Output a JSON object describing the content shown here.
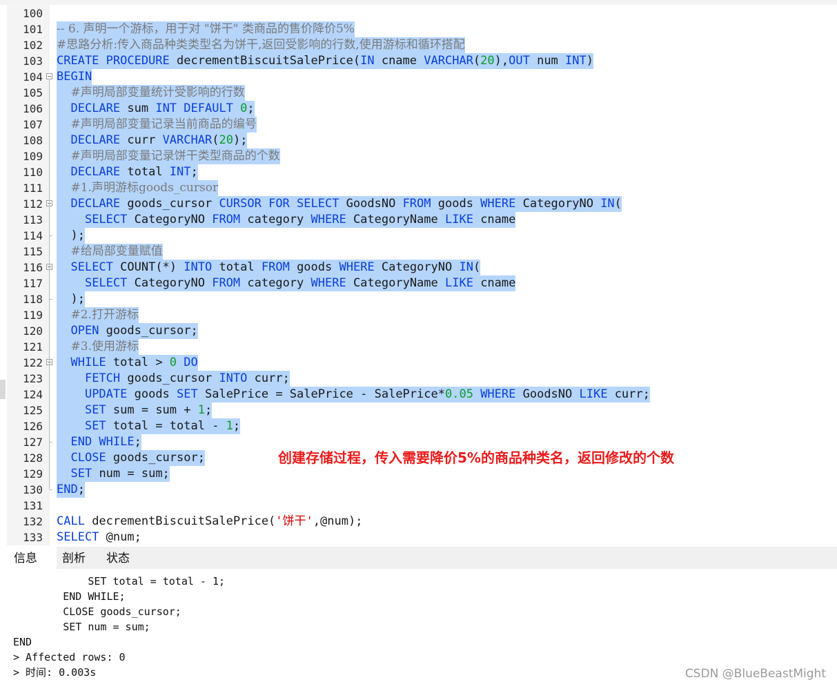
{
  "editor": {
    "lines": [
      {
        "no": "100",
        "tokens": []
      },
      {
        "no": "101",
        "tokens": [
          {
            "t": "-- 6. 声明一个游标，用于对 \"饼干\" 类商品的售价降价5%",
            "c": "c"
          }
        ]
      },
      {
        "no": "102",
        "tokens": [
          {
            "t": "#思路分析:传入商品种类类型名为饼干,返回受影响的行数,使用游标和循环搭配",
            "c": "c"
          }
        ]
      },
      {
        "no": "103",
        "tokens": [
          {
            "t": "CREATE PROCEDURE",
            "c": "k"
          },
          {
            "t": " decrementBiscuitSalePrice(",
            "c": ""
          },
          {
            "t": "IN",
            "c": "k"
          },
          {
            "t": " cname ",
            "c": ""
          },
          {
            "t": "VARCHAR",
            "c": "k"
          },
          {
            "t": "(",
            "c": ""
          },
          {
            "t": "20",
            "c": "n"
          },
          {
            "t": "),",
            "c": ""
          },
          {
            "t": "OUT",
            "c": "k"
          },
          {
            "t": " num ",
            "c": ""
          },
          {
            "t": "INT",
            "c": "k"
          },
          {
            "t": ")",
            "c": ""
          }
        ]
      },
      {
        "no": "104",
        "tokens": [
          {
            "t": "BEGIN",
            "c": "k"
          }
        ]
      },
      {
        "no": "105",
        "tokens": [
          {
            "t": "  ",
            "c": ""
          },
          {
            "t": "#声明局部变量统计受影响的行数",
            "c": "c"
          }
        ]
      },
      {
        "no": "106",
        "tokens": [
          {
            "t": "  ",
            "c": ""
          },
          {
            "t": "DECLARE",
            "c": "k"
          },
          {
            "t": " sum ",
            "c": ""
          },
          {
            "t": "INT DEFAULT",
            "c": "k"
          },
          {
            "t": " ",
            "c": ""
          },
          {
            "t": "0",
            "c": "n"
          },
          {
            "t": ";",
            "c": ""
          }
        ]
      },
      {
        "no": "107",
        "tokens": [
          {
            "t": "  ",
            "c": ""
          },
          {
            "t": "#声明局部变量记录当前商品的编号",
            "c": "c"
          }
        ]
      },
      {
        "no": "108",
        "tokens": [
          {
            "t": "  ",
            "c": ""
          },
          {
            "t": "DECLARE",
            "c": "k"
          },
          {
            "t": " curr ",
            "c": ""
          },
          {
            "t": "VARCHAR",
            "c": "k"
          },
          {
            "t": "(",
            "c": ""
          },
          {
            "t": "20",
            "c": "n"
          },
          {
            "t": ");",
            "c": ""
          }
        ]
      },
      {
        "no": "109",
        "tokens": [
          {
            "t": "  ",
            "c": ""
          },
          {
            "t": "#声明局部变量记录饼干类型商品的个数",
            "c": "c"
          }
        ]
      },
      {
        "no": "110",
        "tokens": [
          {
            "t": "  ",
            "c": ""
          },
          {
            "t": "DECLARE",
            "c": "k"
          },
          {
            "t": " total ",
            "c": ""
          },
          {
            "t": "INT",
            "c": "k"
          },
          {
            "t": ";",
            "c": ""
          }
        ]
      },
      {
        "no": "111",
        "tokens": [
          {
            "t": "  ",
            "c": ""
          },
          {
            "t": "#1.声明游标goods_cursor",
            "c": "c"
          }
        ]
      },
      {
        "no": "112",
        "tokens": [
          {
            "t": "  ",
            "c": ""
          },
          {
            "t": "DECLARE",
            "c": "k"
          },
          {
            "t": " goods_cursor ",
            "c": ""
          },
          {
            "t": "CURSOR FOR SELECT",
            "c": "k"
          },
          {
            "t": " GoodsNO ",
            "c": ""
          },
          {
            "t": "FROM",
            "c": "k"
          },
          {
            "t": " goods ",
            "c": ""
          },
          {
            "t": "WHERE",
            "c": "k"
          },
          {
            "t": " CategoryNO ",
            "c": ""
          },
          {
            "t": "IN",
            "c": "k"
          },
          {
            "t": "(",
            "c": ""
          }
        ]
      },
      {
        "no": "113",
        "tokens": [
          {
            "t": "    ",
            "c": ""
          },
          {
            "t": "SELECT",
            "c": "k"
          },
          {
            "t": " CategoryNO ",
            "c": ""
          },
          {
            "t": "FROM",
            "c": "k"
          },
          {
            "t": " category ",
            "c": ""
          },
          {
            "t": "WHERE",
            "c": "k"
          },
          {
            "t": " CategoryName ",
            "c": ""
          },
          {
            "t": "LIKE",
            "c": "k"
          },
          {
            "t": " cname",
            "c": ""
          }
        ]
      },
      {
        "no": "114",
        "tokens": [
          {
            "t": "  );",
            "c": ""
          }
        ]
      },
      {
        "no": "115",
        "tokens": [
          {
            "t": "  ",
            "c": ""
          },
          {
            "t": "#给局部变量赋值",
            "c": "c"
          }
        ]
      },
      {
        "no": "116",
        "tokens": [
          {
            "t": "  ",
            "c": ""
          },
          {
            "t": "SELECT",
            "c": "k"
          },
          {
            "t": " COUNT(*) ",
            "c": ""
          },
          {
            "t": "INTO",
            "c": "k"
          },
          {
            "t": " total ",
            "c": ""
          },
          {
            "t": "FROM",
            "c": "k"
          },
          {
            "t": " goods ",
            "c": ""
          },
          {
            "t": "WHERE",
            "c": "k"
          },
          {
            "t": " CategoryNO ",
            "c": ""
          },
          {
            "t": "IN",
            "c": "k"
          },
          {
            "t": "(",
            "c": ""
          }
        ]
      },
      {
        "no": "117",
        "tokens": [
          {
            "t": "    ",
            "c": ""
          },
          {
            "t": "SELECT",
            "c": "k"
          },
          {
            "t": " CategoryNO ",
            "c": ""
          },
          {
            "t": "FROM",
            "c": "k"
          },
          {
            "t": " category ",
            "c": ""
          },
          {
            "t": "WHERE",
            "c": "k"
          },
          {
            "t": " CategoryName ",
            "c": ""
          },
          {
            "t": "LIKE",
            "c": "k"
          },
          {
            "t": " cname",
            "c": ""
          }
        ]
      },
      {
        "no": "118",
        "tokens": [
          {
            "t": "  );",
            "c": ""
          }
        ]
      },
      {
        "no": "119",
        "tokens": [
          {
            "t": "  ",
            "c": ""
          },
          {
            "t": "#2.打开游标",
            "c": "c"
          }
        ]
      },
      {
        "no": "120",
        "tokens": [
          {
            "t": "  ",
            "c": ""
          },
          {
            "t": "OPEN",
            "c": "k"
          },
          {
            "t": " goods_cursor;",
            "c": ""
          }
        ]
      },
      {
        "no": "121",
        "tokens": [
          {
            "t": "  ",
            "c": ""
          },
          {
            "t": "#3.使用游标",
            "c": "c"
          }
        ]
      },
      {
        "no": "122",
        "tokens": [
          {
            "t": "  ",
            "c": ""
          },
          {
            "t": "WHILE",
            "c": "k"
          },
          {
            "t": " total > ",
            "c": ""
          },
          {
            "t": "0",
            "c": "n"
          },
          {
            "t": " ",
            "c": ""
          },
          {
            "t": "DO",
            "c": "k"
          }
        ]
      },
      {
        "no": "123",
        "tokens": [
          {
            "t": "    ",
            "c": ""
          },
          {
            "t": "FETCH",
            "c": "k"
          },
          {
            "t": " goods_cursor ",
            "c": ""
          },
          {
            "t": "INTO",
            "c": "k"
          },
          {
            "t": " curr;",
            "c": ""
          }
        ]
      },
      {
        "no": "124",
        "tokens": [
          {
            "t": "    ",
            "c": ""
          },
          {
            "t": "UPDATE",
            "c": "k"
          },
          {
            "t": " goods ",
            "c": ""
          },
          {
            "t": "SET",
            "c": "k"
          },
          {
            "t": " SalePrice = SalePrice - SalePrice*",
            "c": ""
          },
          {
            "t": "0.05",
            "c": "n"
          },
          {
            "t": " ",
            "c": ""
          },
          {
            "t": "WHERE",
            "c": "k"
          },
          {
            "t": " GoodsNO ",
            "c": ""
          },
          {
            "t": "LIKE",
            "c": "k"
          },
          {
            "t": " curr;",
            "c": ""
          }
        ]
      },
      {
        "no": "125",
        "tokens": [
          {
            "t": "    ",
            "c": ""
          },
          {
            "t": "SET",
            "c": "k"
          },
          {
            "t": " sum = sum + ",
            "c": ""
          },
          {
            "t": "1",
            "c": "n"
          },
          {
            "t": ";",
            "c": ""
          }
        ]
      },
      {
        "no": "126",
        "tokens": [
          {
            "t": "    ",
            "c": ""
          },
          {
            "t": "SET",
            "c": "k"
          },
          {
            "t": " total = total - ",
            "c": ""
          },
          {
            "t": "1",
            "c": "n"
          },
          {
            "t": ";",
            "c": ""
          }
        ]
      },
      {
        "no": "127",
        "tokens": [
          {
            "t": "  ",
            "c": ""
          },
          {
            "t": "END WHILE",
            "c": "k"
          },
          {
            "t": ";",
            "c": ""
          }
        ]
      },
      {
        "no": "128",
        "tokens": [
          {
            "t": "  ",
            "c": ""
          },
          {
            "t": "CLOSE",
            "c": "k"
          },
          {
            "t": " goods_cursor;",
            "c": ""
          }
        ]
      },
      {
        "no": "129",
        "tokens": [
          {
            "t": "  ",
            "c": ""
          },
          {
            "t": "SET",
            "c": "k"
          },
          {
            "t": " num = sum;",
            "c": ""
          }
        ]
      },
      {
        "no": "130",
        "tokens": [
          {
            "t": "END",
            "c": "k"
          },
          {
            "t": ";",
            "c": ""
          }
        ]
      },
      {
        "no": "131",
        "tokens": []
      },
      {
        "no": "132",
        "tokens": [
          {
            "t": "CALL",
            "c": "k"
          },
          {
            "t": " decrementBiscuitSalePrice(",
            "c": ""
          },
          {
            "t": "'饼干'",
            "c": "s"
          },
          {
            "t": ",@num);",
            "c": ""
          }
        ]
      },
      {
        "no": "133",
        "tokens": [
          {
            "t": "SELECT",
            "c": "k"
          },
          {
            "t": " @num;",
            "c": ""
          }
        ]
      }
    ]
  },
  "annotation": "创建存储过程，传入需要降价5%的商品种类名，返回修改的个数",
  "tabs": [
    {
      "label": "信息",
      "active": true
    },
    {
      "label": "剖析",
      "active": false
    },
    {
      "label": "状态",
      "active": false
    }
  ],
  "output": {
    "lines": [
      "            SET total = total - 1;",
      "        END WHILE;",
      "        CLOSE goods_cursor;",
      "        SET num = sum;",
      "END",
      "> Affected rows: 0",
      "> 时间: 0.003s"
    ]
  },
  "watermark": "CSDN @BlueBeastMight",
  "colors": {
    "keyword": "#0a3fd6",
    "number": "#0a9c2c",
    "comment": "#7b7b7b",
    "string": "#d40000",
    "selection": "#b5d5fb",
    "annotation": "#e81c1c"
  }
}
